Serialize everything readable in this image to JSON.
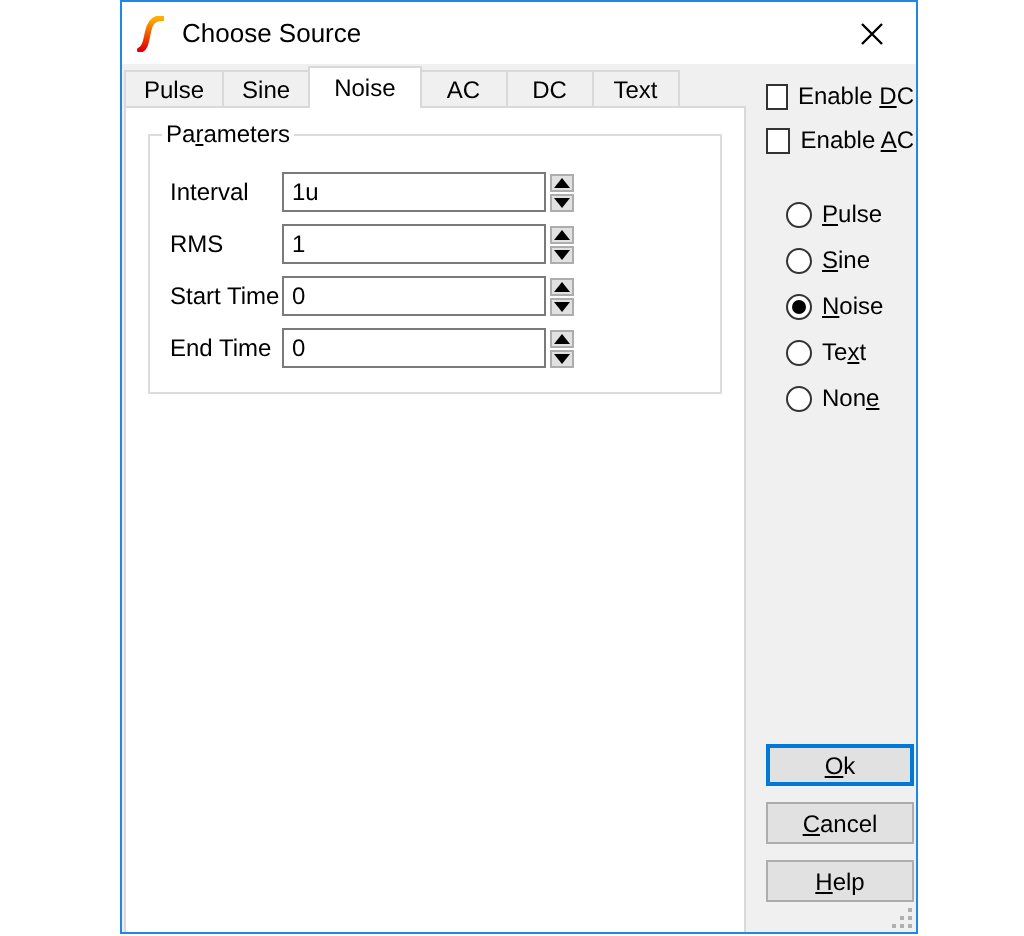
{
  "window": {
    "title": "Choose Source"
  },
  "tabs": [
    {
      "label": "Pulse",
      "selected": false
    },
    {
      "label": "Sine",
      "selected": false
    },
    {
      "label": "Noise",
      "selected": true
    },
    {
      "label": "AC",
      "selected": false
    },
    {
      "label": "DC",
      "selected": false
    },
    {
      "label": "Text",
      "selected": false
    }
  ],
  "parameters": {
    "title": {
      "before": "Pa",
      "key": "r",
      "after": "ameters"
    },
    "fields": [
      {
        "label": "Interval",
        "value": "1u"
      },
      {
        "label": "RMS",
        "value": "1"
      },
      {
        "label": "Start Time",
        "value": "0"
      },
      {
        "label": "End Time",
        "value": "0"
      }
    ]
  },
  "checkboxes": [
    {
      "label": {
        "before": "Enable ",
        "key": "D",
        "after": "C"
      },
      "checked": false
    },
    {
      "label": {
        "before": "Enable ",
        "key": "A",
        "after": "C"
      },
      "checked": false
    }
  ],
  "radios": [
    {
      "label": {
        "key": "P",
        "after": "ulse"
      },
      "selected": false
    },
    {
      "label": {
        "key": "S",
        "after": "ine"
      },
      "selected": false
    },
    {
      "label": {
        "key": "N",
        "after": "oise"
      },
      "selected": true
    },
    {
      "label": {
        "before": "Te",
        "key": "x",
        "after": "t"
      },
      "selected": false
    },
    {
      "label": {
        "before": "Non",
        "key": "e"
      },
      "selected": false
    }
  ],
  "buttons": [
    {
      "label": {
        "key": "O",
        "after": "k"
      },
      "default": true
    },
    {
      "label": {
        "key": "C",
        "after": "ancel"
      },
      "default": false
    },
    {
      "label": {
        "key": "H",
        "after": "elp"
      },
      "default": false
    }
  ]
}
